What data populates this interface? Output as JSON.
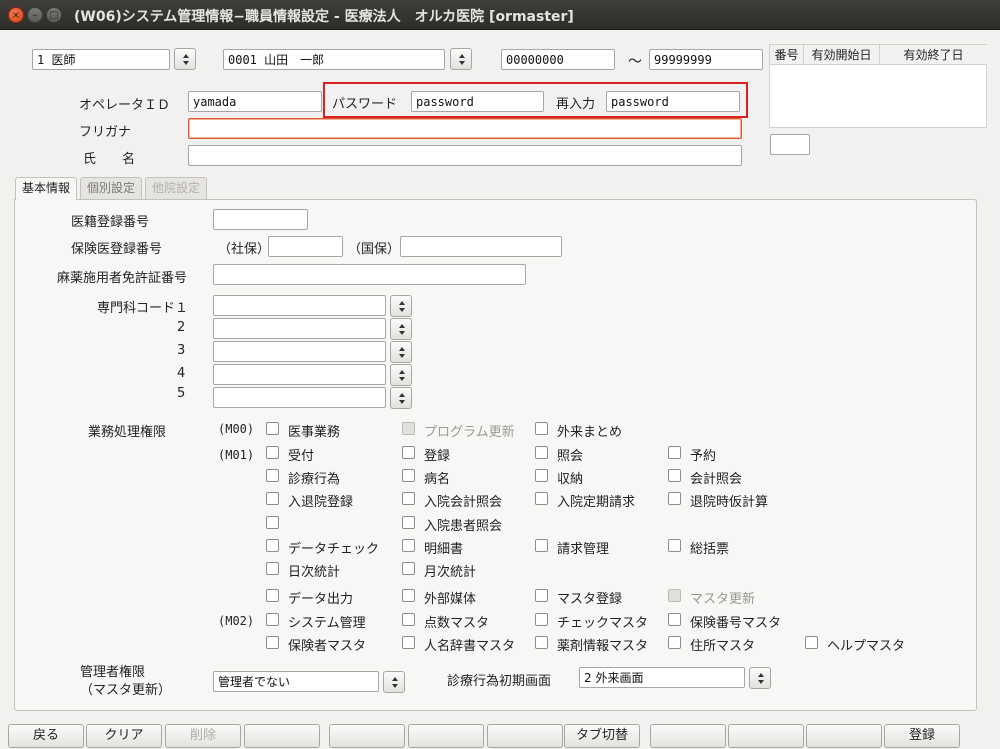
{
  "window": {
    "title": "(W06)システム管理情報−職員情報設定 - 医療法人　オルカ医院 [ormaster]"
  },
  "top": {
    "occupation": "1 医師",
    "staff": "0001 山田　一郎",
    "range_from": "00000000",
    "range_sep": "〜",
    "range_to": "99999999"
  },
  "period_table": {
    "headers": [
      "番号",
      "有効開始日",
      "有効終了日"
    ],
    "number_value": ""
  },
  "account": {
    "operator_label": "オペレータＩＤ",
    "operator_value": "yamada",
    "password_label": "パスワード",
    "password_value": "password",
    "reenter_label": "再入力",
    "reenter_value": "password",
    "furigana_label": "フリガナ",
    "furigana_value": "",
    "name_label": "氏　　名",
    "name_value": ""
  },
  "tabs": [
    {
      "label": "基本情報"
    },
    {
      "label": "個別設定"
    },
    {
      "label": "他院設定"
    }
  ],
  "basic": {
    "medical_reg_label": "医籍登録番号",
    "insurance_doc_label": "保険医登録番号",
    "shaho_label": "（社保）",
    "kokuho_label": "（国保）",
    "narcotic_label": "麻薬施用者免許証番号",
    "specialty_label": "専門科コード１",
    "specialty_nums": [
      "2",
      "3",
      "4",
      "5"
    ],
    "auth_label": "業務処理権限",
    "group_m00": "(M00)",
    "group_m01": "(M01)",
    "group_m02": "(M02)",
    "checks": {
      "c1": "医事業務",
      "c2": "プログラム更新",
      "c3": "外来まとめ",
      "c4": "受付",
      "c5": "登録",
      "c6": "照会",
      "c7": "予約",
      "c8": "診療行為",
      "c9": "病名",
      "c10": "収納",
      "c11": "会計照会",
      "c12": "入退院登録",
      "c13": "入院会計照会",
      "c14": "入院定期請求",
      "c15": "退院時仮計算",
      "c16": "入院患者照会",
      "c17": "データチェック",
      "c18": "明細書",
      "c19": "請求管理",
      "c20": "総括票",
      "c21": "日次統計",
      "c22": "月次統計",
      "c23": "データ出力",
      "c24": "外部媒体",
      "c25": "マスタ登録",
      "c26": "マスタ更新",
      "c27": "システム管理",
      "c28": "点数マスタ",
      "c29": "チェックマスタ",
      "c30": "保険番号マスタ",
      "c31": "保険者マスタ",
      "c32": "人名辞書マスタ",
      "c33": "薬剤情報マスタ",
      "c34": "住所マスタ",
      "c35": "ヘルプマスタ"
    },
    "admin_label_1": "管理者権限",
    "admin_label_2": "（マスタ更新）",
    "admin_value": "管理者でない",
    "initial_screen_label": "診療行為初期画面",
    "initial_screen_value": "2 外来画面"
  },
  "footer": {
    "back": "戻る",
    "clear": "クリア",
    "delete": "削除",
    "tab_switch": "タブ切替",
    "register": "登録"
  }
}
